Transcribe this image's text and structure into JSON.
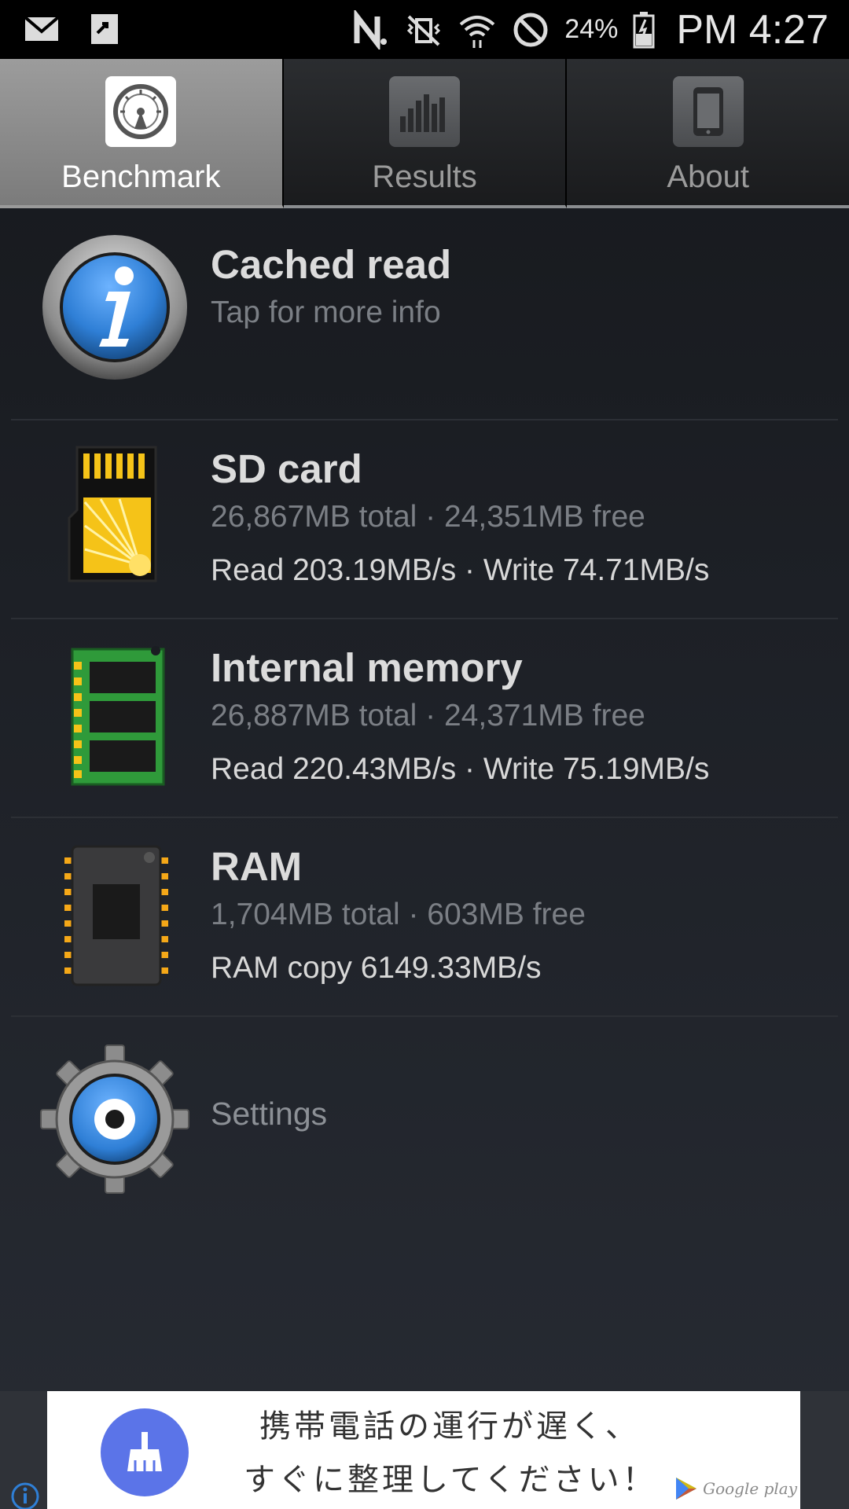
{
  "status_bar": {
    "battery_percent": "24%",
    "time": "PM 4:27",
    "left_icons": [
      "gmail-icon",
      "screenshot-share-icon"
    ],
    "right_icons": [
      "nfc-icon",
      "vibrate-mute-icon",
      "wifi-icon",
      "do-not-disturb-icon",
      "battery-charging-icon"
    ]
  },
  "tabs": [
    {
      "label": "Benchmark",
      "icon": "speedometer-icon",
      "active": true
    },
    {
      "label": "Results",
      "icon": "bar-chart-icon",
      "active": false
    },
    {
      "label": "About",
      "icon": "phone-icon",
      "active": false
    }
  ],
  "list": {
    "cached": {
      "title": "Cached read",
      "subtitle": "Tap for more info",
      "icon": "info-icon"
    },
    "sd": {
      "title": "SD card",
      "capacity": "26,867MB total · 24,351MB free",
      "speed": "Read 203.19MB/s · Write 74.71MB/s",
      "icon": "sd-card-icon"
    },
    "internal": {
      "title": "Internal memory",
      "capacity": "26,887MB total · 24,371MB free",
      "speed": "Read 220.43MB/s · Write 75.19MB/s",
      "icon": "memory-module-icon"
    },
    "ram": {
      "title": "RAM",
      "capacity": "1,704MB total · 603MB free",
      "speed": "RAM copy 6149.33MB/s",
      "icon": "chip-icon"
    },
    "settings": {
      "label": "Settings",
      "icon": "gear-icon"
    }
  },
  "ad": {
    "line1": "携帯電話の運行が遅く、",
    "line2": "すぐに整理してください！",
    "store_badge": "Google play",
    "icon": "broom-icon"
  },
  "colors": {
    "accent_blue": "#2f7fd6",
    "sd_yellow": "#f5c318",
    "memory_green": "#2f9a3a",
    "ad_brush": "#5b74e8"
  }
}
